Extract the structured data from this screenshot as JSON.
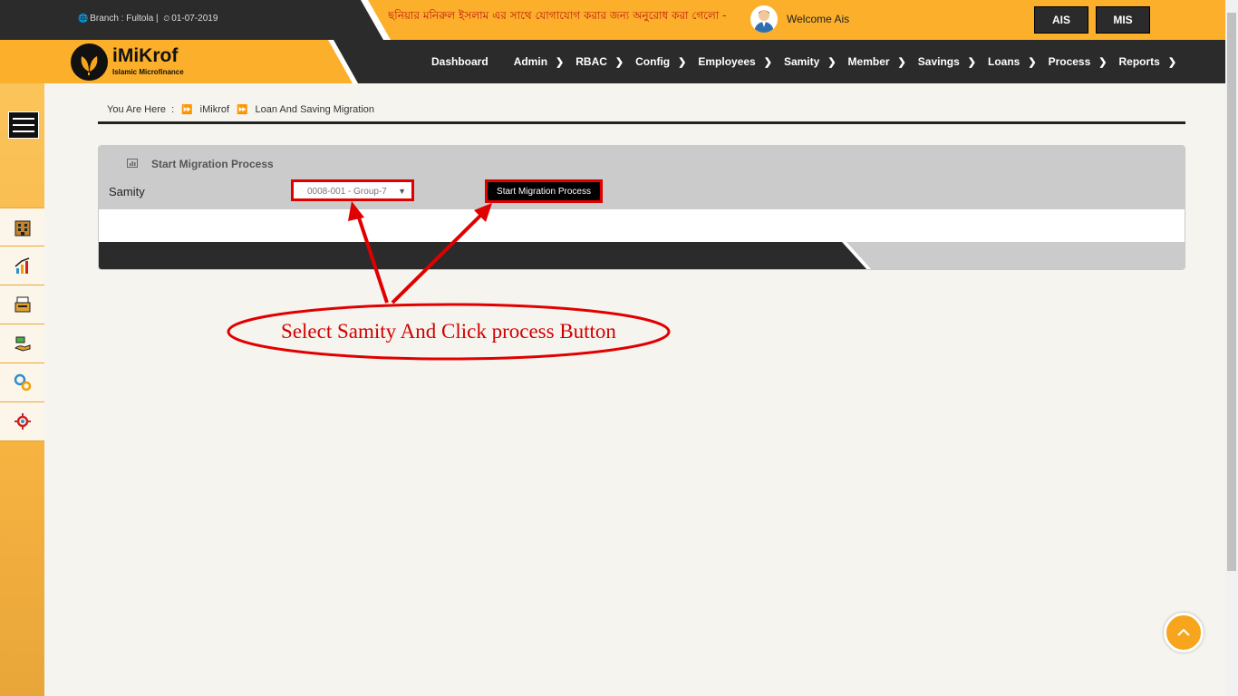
{
  "header": {
    "branch_label": "Branch : Fultola |",
    "date": "01-07-2019",
    "notice_marquee": "ছনিয়ার মনিরুল ইসলাম এর সাথে যোগাযোগ করার জন্য অনুরোধ করা গেলো - ০১",
    "welcome": "Welcome Ais",
    "ais_button": "AIS",
    "mis_button": "MIS"
  },
  "logo": {
    "name": "iMiKrof",
    "subtitle": "Islamic Microfinance"
  },
  "nav": {
    "items": [
      {
        "label": "Dashboard"
      },
      {
        "label": "Admin"
      },
      {
        "label": "RBAC"
      },
      {
        "label": "Config"
      },
      {
        "label": "Employees"
      },
      {
        "label": "Samity"
      },
      {
        "label": "Member"
      },
      {
        "label": "Savings"
      },
      {
        "label": "Loans"
      },
      {
        "label": "Process"
      },
      {
        "label": "Reports"
      }
    ]
  },
  "sidebar": {
    "icons": [
      "building-icon",
      "growth-chart-icon",
      "cash-register-icon",
      "money-hand-icon",
      "gears-icon",
      "settings-icon"
    ]
  },
  "breadcrumb": {
    "prefix": "You Are Here",
    "colon": ":",
    "level1": "iMikrof",
    "level2": "Loan And Saving Migration"
  },
  "panel": {
    "title": "Start Migration Process",
    "samity_label": "Samity",
    "samity_selected": "0008-001 - Group-7",
    "start_button": "Start Migration Process"
  },
  "annotation": {
    "text": "Select Samity And Click process Button",
    "color": "#d10000"
  },
  "colors": {
    "accent": "#fbaf2b",
    "dark": "#2b2b2b",
    "highlight": "#e00000"
  }
}
